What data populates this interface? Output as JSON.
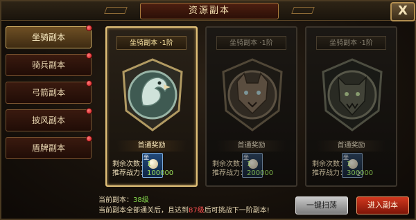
{
  "window": {
    "title": "资源副本",
    "close_label": "X"
  },
  "sidebar": {
    "items": [
      {
        "label": "坐骑副本",
        "active": true,
        "has_notice": true
      },
      {
        "label": "骑兵副本",
        "active": false,
        "has_notice": true
      },
      {
        "label": "弓箭副本",
        "active": false,
        "has_notice": true
      },
      {
        "label": "披风副本",
        "active": false,
        "has_notice": true
      },
      {
        "label": "盾牌副本",
        "active": false,
        "has_notice": true
      }
    ]
  },
  "cards": [
    {
      "title": "坐骑副本 ·1阶",
      "reward_label": "首通奖励",
      "reward_tag": "坐",
      "reward_count": "",
      "remaining_label": "剩余次数：",
      "remaining_value": "1",
      "power_label": "推荐战力：",
      "power_value": "100000",
      "emblem": "eagle-emblem-icon",
      "selected": true,
      "dimmed": false
    },
    {
      "title": "坐骑副本 ·1阶",
      "reward_label": "首通奖励",
      "reward_tag": "坐",
      "reward_count": "",
      "remaining_label": "剩余次数：",
      "remaining_value": "1",
      "power_label": "推荐战力：",
      "power_value": "200000",
      "emblem": "wolf-emblem-icon",
      "selected": false,
      "dimmed": true
    },
    {
      "title": "坐骑副本 ·1阶",
      "reward_label": "首通奖励",
      "reward_tag": "坐",
      "reward_count": "2",
      "remaining_label": "剩余次数：",
      "remaining_value": "1",
      "power_label": "推荐战力：",
      "power_value": "300000",
      "emblem": "demon-emblem-icon",
      "selected": false,
      "dimmed": true
    }
  ],
  "footer": {
    "current_label": "当前副本：",
    "current_value": "38级",
    "hint_prefix": "当前副本全部通关后，且达到",
    "hint_level": "87级",
    "hint_suffix": "后可挑战下一阶副本!",
    "sweep_label": "一键扫荡",
    "enter_label": "进入副本"
  },
  "colors": {
    "accent_gold": "#e3c27a",
    "value_green": "#85d84c",
    "level_red": "#ff5050",
    "enter_red": "#d2381e"
  }
}
